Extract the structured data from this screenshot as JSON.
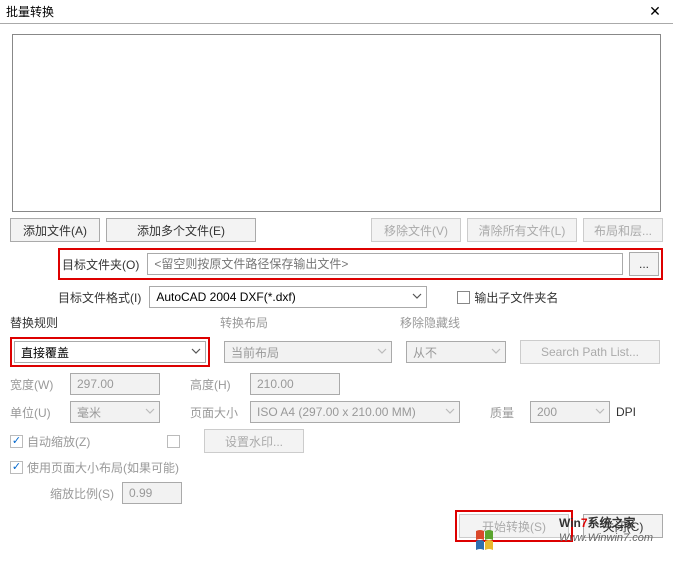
{
  "title": "批量转换",
  "buttons": {
    "add_file": "添加文件(A)",
    "add_multi": "添加多个文件(E)",
    "remove_file": "移除文件(V)",
    "clear_all": "清除所有文件(L)",
    "layout_layers": "布局和层...",
    "set_watermark": "设置水印...",
    "start_conv": "开始转换(S)",
    "close": "关闭(C)",
    "search_path": "Search Path List..."
  },
  "labels": {
    "target_folder": "目标文件夹(O)",
    "target_format": "目标文件格式(I)",
    "output_subfolder": "输出子文件夹名",
    "replace_rules": "替换规则",
    "convert_layout": "转换布局",
    "remove_hidden": "移除隐藏线",
    "width": "宽度(W)",
    "height": "高度(H)",
    "unit": "单位(U)",
    "page_size": "页面大小",
    "quality": "质量",
    "dpi": "DPI",
    "auto_scale": "自动缩放(Z)",
    "use_page_layout": "使用页面大小布局(如果可能)",
    "scale_ratio": "缩放比例(S)"
  },
  "values": {
    "folder_placeholder": "<留空则按原文件路径保存输出文件>",
    "format": "AutoCAD 2004 DXF(*.dxf)",
    "replace_rule": "直接覆盖",
    "layout_current": "当前布局",
    "hidden_never": "从不",
    "width_val": "297.00",
    "height_val": "210.00",
    "unit_val": "毫米",
    "page_size_val": "ISO A4 (297.00 x 210.00 MM)",
    "quality_val": "200",
    "scale_val": "0.99"
  },
  "watermark": {
    "seven": "7",
    "line1_rest": "系统之家",
    "line1_prefix": "Win",
    "line2": "Www.Winwin7.com"
  }
}
